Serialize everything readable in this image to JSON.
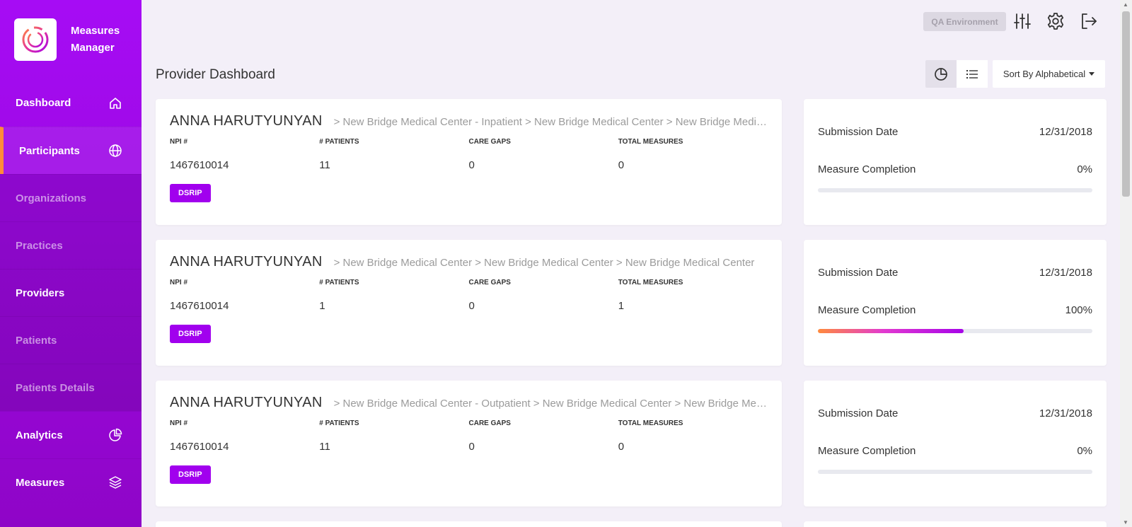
{
  "app": {
    "name": "Measures Manager"
  },
  "sidebar": {
    "items": [
      {
        "label": "Dashboard",
        "icon": "home-icon"
      },
      {
        "label": "Participants",
        "icon": "globe-icon"
      },
      {
        "label": "Organizations"
      },
      {
        "label": "Practices"
      },
      {
        "label": "Providers"
      },
      {
        "label": "Patients"
      },
      {
        "label": "Patients Details"
      },
      {
        "label": "Analytics",
        "icon": "pie-chart-icon"
      },
      {
        "label": "Measures",
        "icon": "layers-icon"
      }
    ]
  },
  "header": {
    "environment": "QA Environment",
    "icons": [
      "sliders-icon",
      "gear-icon",
      "logout-icon"
    ]
  },
  "page": {
    "title": "Provider Dashboard",
    "sort_label": "Sort By Alphabetical"
  },
  "colors": {
    "accent": "#a100ee",
    "sidebar_top": "#a60cf5",
    "sidebar_bottom": "#8f05c7",
    "active_marker": "#ff8c3a"
  },
  "stat_labels": {
    "npi": "NPI #",
    "patients": "# PATIENTS",
    "care_gaps": "CARE GAPS",
    "total_measures": "TOTAL MEASURES"
  },
  "summary_labels": {
    "submission": "Submission Date",
    "completion": "Measure Completion"
  },
  "providers": [
    {
      "name": "ANNA HARUTYUNYAN",
      "path": "> New Bridge Medical Center - Inpatient > New Bridge Medical Center > New Bridge Medical Center",
      "npi": "1467610014",
      "patients": "11",
      "care_gaps": "0",
      "total_measures": "0",
      "tag": "DSRIP",
      "submission_date": "12/31/2018",
      "completion": "0%",
      "bar_fraction": 0
    },
    {
      "name": "ANNA HARUTYUNYAN",
      "path": "> New Bridge Medical Center > New Bridge Medical Center > New Bridge Medical Center",
      "npi": "1467610014",
      "patients": "1",
      "care_gaps": "0",
      "total_measures": "1",
      "tag": "DSRIP",
      "submission_date": "12/31/2018",
      "completion": "100%",
      "bar_fraction": 0.53
    },
    {
      "name": "ANNA HARUTYUNYAN",
      "path": "> New Bridge Medical Center - Outpatient > New Bridge Medical Center > New Bridge Medical Center",
      "npi": "1467610014",
      "patients": "11",
      "care_gaps": "0",
      "total_measures": "0",
      "tag": "DSRIP",
      "submission_date": "12/31/2018",
      "completion": "0%",
      "bar_fraction": 0
    }
  ]
}
